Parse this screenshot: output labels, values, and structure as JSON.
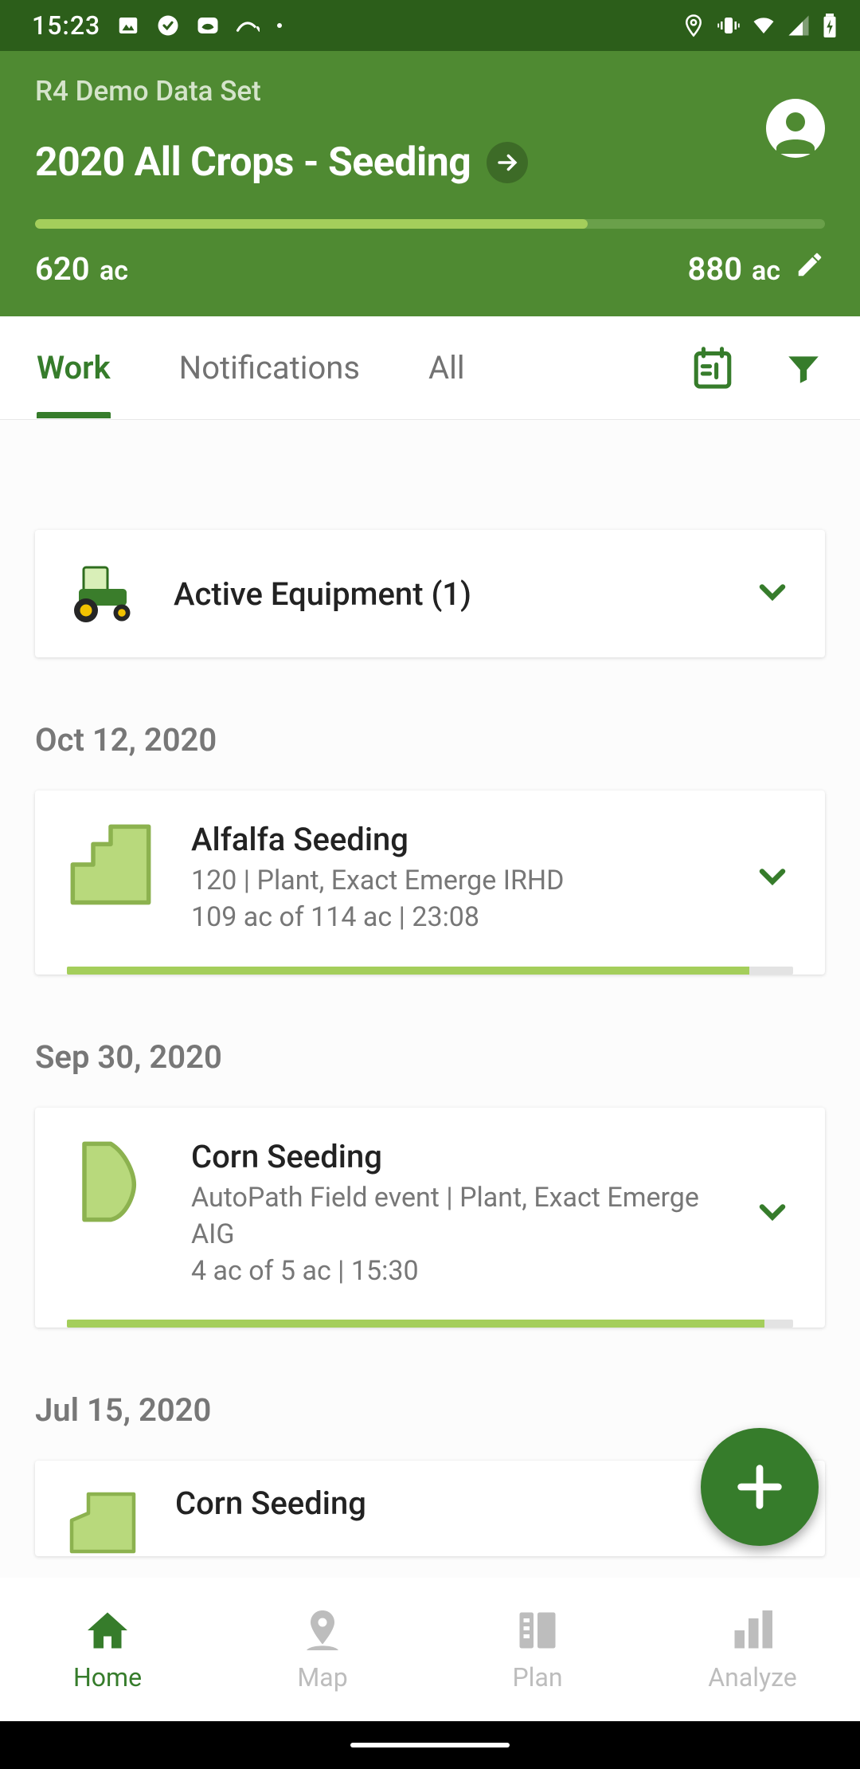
{
  "status": {
    "time": "15:23"
  },
  "header": {
    "org": "R4 Demo Data Set",
    "title": "2020 All Crops - Seeding",
    "progress_pct": 70,
    "acres_done": "620",
    "acres_done_unit": "ac",
    "acres_total": "880",
    "acres_total_unit": "ac"
  },
  "tabs": {
    "items": [
      "Work",
      "Notifications",
      "All"
    ],
    "active_index": 0
  },
  "equipment": {
    "title": "Active Equipment (1)"
  },
  "sections": [
    {
      "date": "Oct 12, 2020",
      "title": "Alfalfa Seeding",
      "line1": "120 | Plant, Exact Emerge IRHD",
      "line2": "109 ac of 114 ac | 23:08",
      "pct": 94
    },
    {
      "date": "Sep 30, 2020",
      "title": "Corn Seeding",
      "line1": "AutoPath Field event | Plant, Exact Emerge AIG",
      "line2": "4 ac of 5 ac | 15:30",
      "pct": 96
    },
    {
      "date": "Jul 15, 2020",
      "title": "Corn Seeding",
      "line1": "",
      "line2": "",
      "pct": 0
    }
  ],
  "nav": {
    "items": [
      "Home",
      "Map",
      "Plan",
      "Analyze"
    ],
    "active_index": 0
  }
}
